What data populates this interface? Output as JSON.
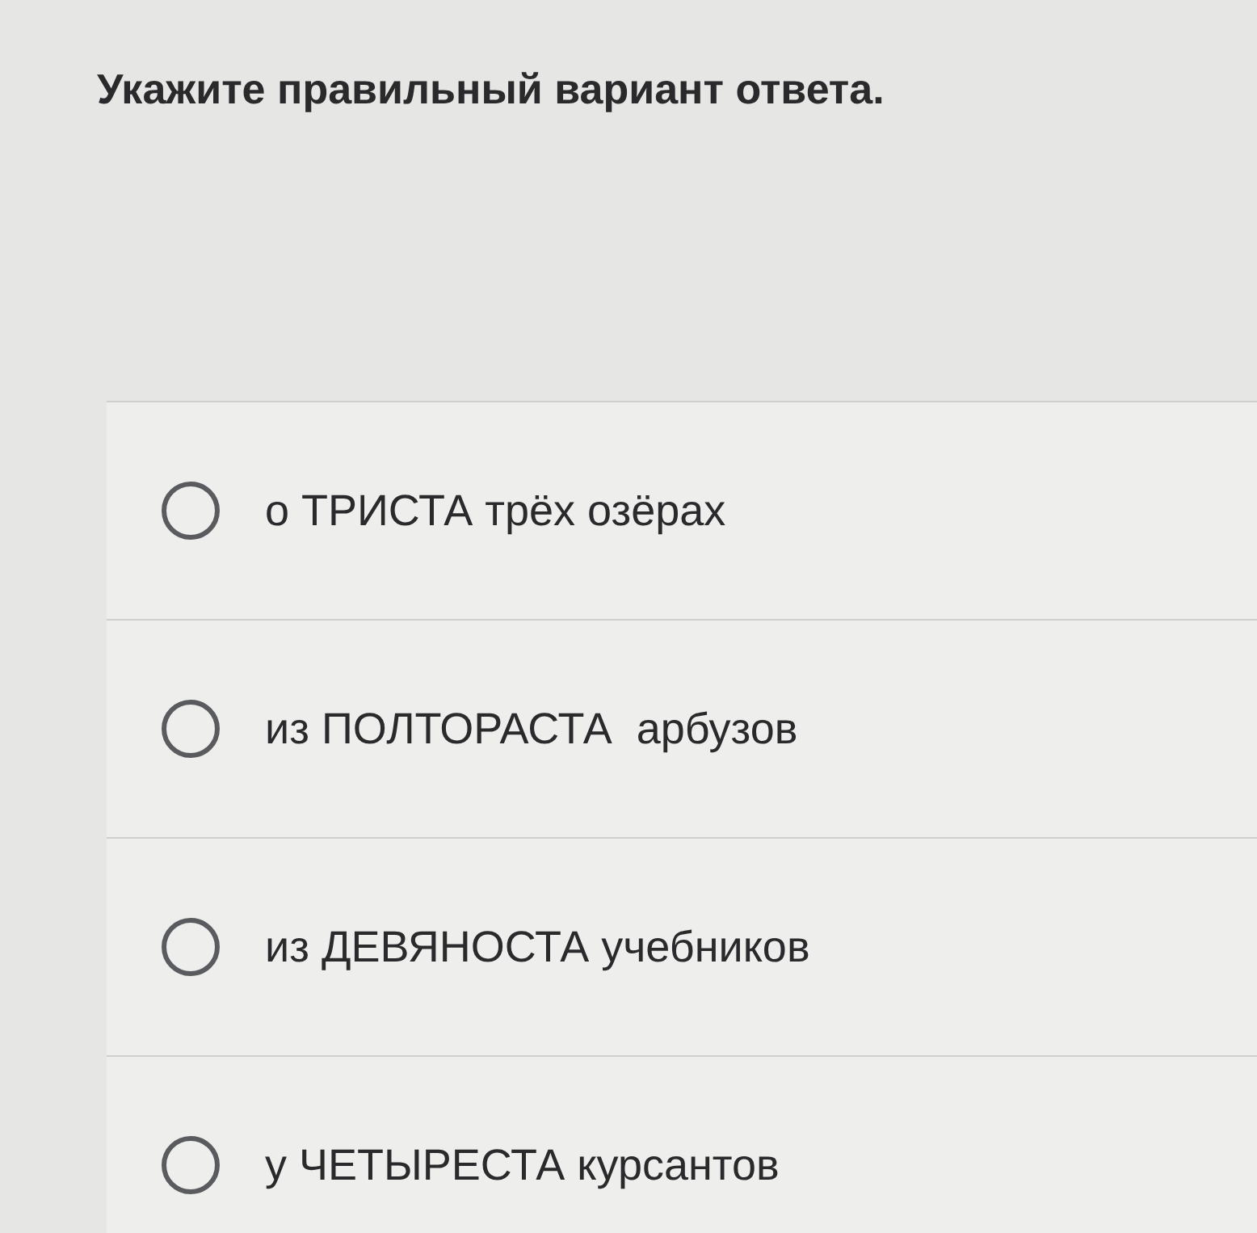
{
  "question": "Укажите правильный вариант ответа.",
  "options": [
    {
      "label": "о ТРИСТА трёх озёрах",
      "selected": false
    },
    {
      "label": "из ПОЛТОРАСТА  арбузов",
      "selected": false
    },
    {
      "label": "из ДЕВЯНОСТА учебников",
      "selected": false
    },
    {
      "label": "у ЧЕТЫРЕСТА курсантов",
      "selected": false
    }
  ]
}
